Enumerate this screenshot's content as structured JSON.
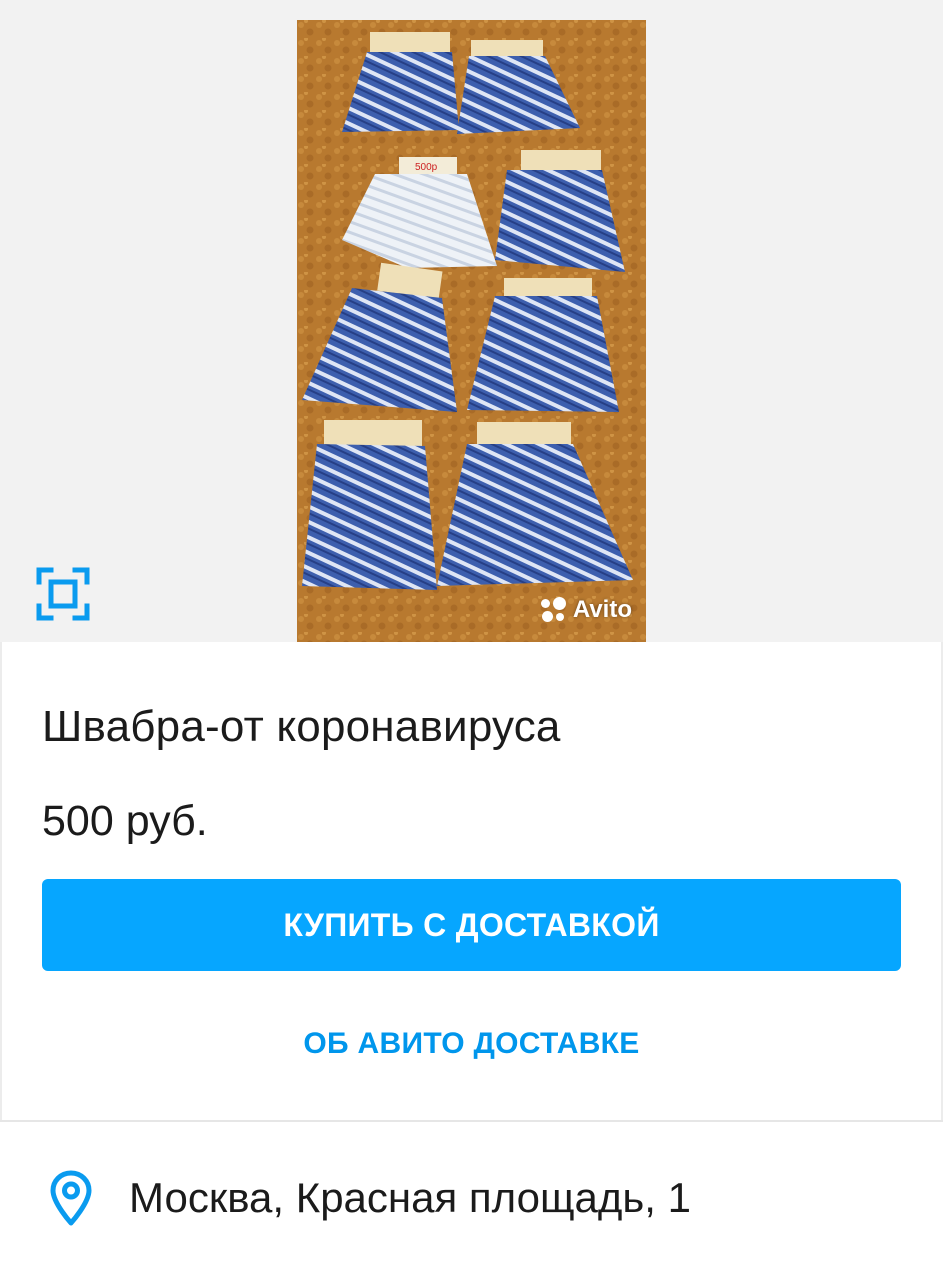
{
  "gallery": {
    "watermark_text": "Avito",
    "price_tag_text": "500р",
    "fullscreen_icon": "fullscreen-frame-icon"
  },
  "listing": {
    "title": "Швабра-от коронавируса",
    "price": "500 руб."
  },
  "actions": {
    "buy_label": "КУПИТЬ С ДОСТАВКОЙ",
    "about_delivery_label": "ОБ АВИТО ДОСТАВКЕ"
  },
  "location": {
    "icon": "map-pin-icon",
    "address": "Москва, Красная площадь, 1"
  },
  "colors": {
    "accent": "#06a6ff",
    "link": "#0096ec",
    "icon": "#0a9bef"
  }
}
